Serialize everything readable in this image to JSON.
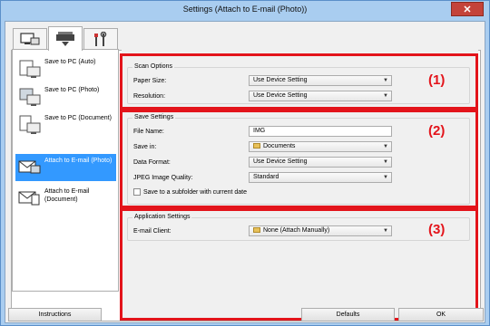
{
  "window": {
    "title": "Settings (Attach to E-mail (Photo))",
    "close_glyph": "✕"
  },
  "tabs": [
    {
      "icon": "scan-from-computer-icon"
    },
    {
      "icon": "scanner-icon"
    },
    {
      "icon": "tools-icon"
    }
  ],
  "sidebar": {
    "items": [
      {
        "label": "Save to PC (Auto)",
        "icon": "save-to-pc-auto-icon",
        "selected": false
      },
      {
        "label": "Save to PC (Photo)",
        "icon": "save-to-pc-photo-icon",
        "selected": false
      },
      {
        "label": "Save to PC (Document)",
        "icon": "save-to-pc-document-icon",
        "selected": false
      },
      {
        "label": "Attach to E-mail (Photo)",
        "icon": "email-photo-icon",
        "selected": true
      },
      {
        "label": "Attach to E-mail (Document)",
        "icon": "email-document-icon",
        "selected": false
      }
    ]
  },
  "scan_options": {
    "title": "Scan Options",
    "paper_size_label": "Paper Size:",
    "paper_size_value": "Use Device Setting",
    "resolution_label": "Resolution:",
    "resolution_value": "Use Device Setting",
    "callout": "(1)"
  },
  "save_settings": {
    "title": "Save Settings",
    "file_name_label": "File Name:",
    "file_name_value": "IMG",
    "save_in_label": "Save in:",
    "save_in_value": "Documents",
    "data_format_label": "Data Format:",
    "data_format_value": "Use Device Setting",
    "jpeg_quality_label": "JPEG Image Quality:",
    "jpeg_quality_value": "Standard",
    "subfolder_label": "Save to a subfolder with current date",
    "subfolder_checked": false,
    "callout": "(2)"
  },
  "application_settings": {
    "title": "Application Settings",
    "email_client_label": "E-mail Client:",
    "email_client_value": "None (Attach Manually)",
    "callout": "(3)"
  },
  "footer": {
    "instructions_label": "Instructions",
    "defaults_label": "Defaults",
    "ok_label": "OK"
  },
  "colors": {
    "highlight": "#e3141b",
    "selection": "#3399ff"
  }
}
